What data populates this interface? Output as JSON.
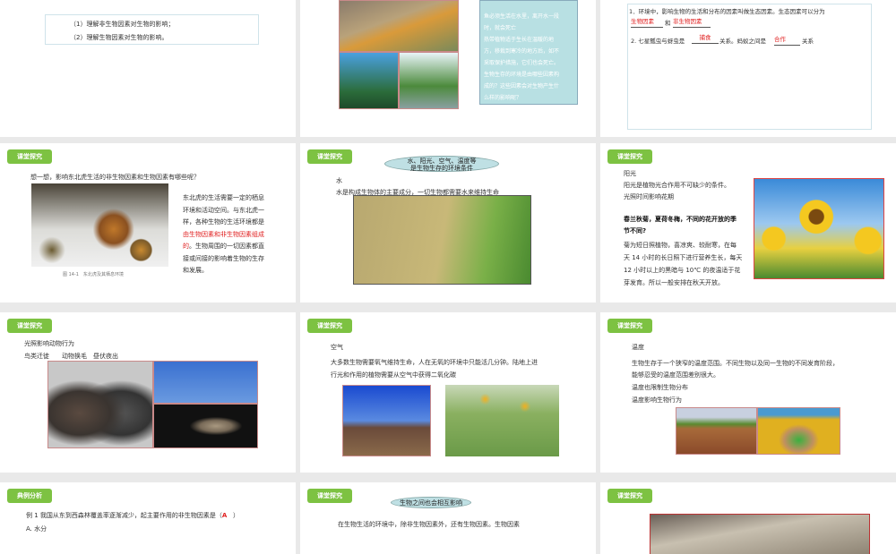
{
  "slides": [
    {
      "objectives": [
        "（1）理解非生物因素对生物的影响；",
        "（2）理解生物因素对生物的影响。"
      ]
    },
    {
      "box_lines": [
        "鱼必须生活在水里，离开水一段",
        "时，就会死亡",
        "热带植物适于生长在温暖的地",
        "方，移栽到寒冷的地方后，如不",
        "采取保护措施，它们也会死亡。",
        "生物生存的环境是由哪些因素构",
        "成的？这些因素会对生物产生什",
        "么样的影响呢？"
      ]
    },
    {
      "q1": "1．环境中，影响生物的生活和分布的因素叫做生态因素。生态因素可以分为",
      "a1": "生物因素",
      "and": "和",
      "a2": "非生物因素",
      "q2a": "2. 七星瓢虫与蚜虫是",
      "a3": "捕食",
      "q2b": "关系。蚂蚁之间是",
      "a4": "合作",
      "q2c": "关系"
    },
    {
      "tag": "课堂探究",
      "question": "想一想，影响东北虎生活的非生物因素和生物因素有哪些呢？",
      "caption": "图 14-1　东北虎及其栖息环境",
      "p1": [
        "东北虎的生活需要一定的栖息",
        "环境和活动空间。与东北虎一",
        "样，各种生物的生活环境都是"
      ],
      "p_red1": "由生物因素和非生物因素组成",
      "p_red2": "的",
      "p2": [
        "。生物周围的一切因素都直",
        "接或间接的影响着生物的生存",
        "和发展。"
      ]
    },
    {
      "tag": "课堂探究",
      "oval": [
        "水、阳光、空气、温度等",
        "是生物生存的环境条件"
      ],
      "heading": "水",
      "text": "水是构成生物体的主要成分，一切生物都需要水来维持生命"
    },
    {
      "tag": "课堂探究",
      "lines": [
        "阳光",
        "阳光是植物光合作用不可缺少的条件。",
        "光照时间影响花期"
      ],
      "bold": [
        "春兰秋菊，夏荷冬梅，不同的花开放的季",
        "节不同?"
      ],
      "para": [
        "菊为短日照植物，喜凉爽、较耐寒，在每",
        "天 14 小时的长日照下进行营养生长，每天",
        "12 小时以上的黑暗与 10℃ 的夜温适于花",
        "芽发育。所以一般安排在秋天开放。"
      ]
    },
    {
      "tag": "课堂探究",
      "lines": [
        "光照影响动物行为",
        "鸟类迁徙　　动物换毛　昼伏夜出"
      ]
    },
    {
      "tag": "课堂探究",
      "lines": [
        "空气",
        "大多数生物需要氧气维持生命，人在无氧的环境中只能活几分钟。陆地上进",
        "行光和作用的植物需要从空气中获得二氧化碳"
      ]
    },
    {
      "tag": "课堂探究",
      "lines": [
        "温度",
        "生物生存于一个狭窄的温度范围。不同生物以及同一生物的不同发育阶段，",
        "能够忍受的温度范围差别很大。",
        "温度也限制生物分布",
        "温度影响生物行为"
      ]
    },
    {
      "tag": "典例分析",
      "q": "例 1  我国从东到西森林覆盖率逐渐减少，起主要作用的非生物因素是（",
      "ans": "A",
      "close": "）",
      "opt": "A. 水分"
    },
    {
      "tag": "课堂探究",
      "oval": "生物之间也会相互影响",
      "text": "在生物生活的环境中，除非生物因素外，还有生物因素。生物因素"
    },
    {
      "tag": "课堂探究"
    }
  ]
}
